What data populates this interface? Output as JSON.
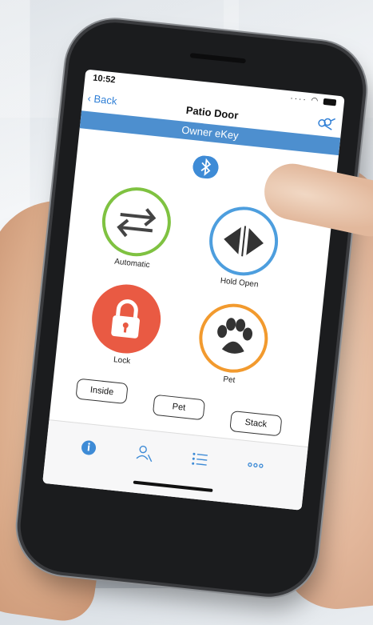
{
  "status": {
    "time": "10:52",
    "signal": "····"
  },
  "nav": {
    "back_label": "Back",
    "title": "Patio Door"
  },
  "banner": {
    "label": "Owner eKey"
  },
  "modes": [
    {
      "label": "Automatic",
      "color": "#7fc241"
    },
    {
      "label": "Hold Open",
      "color": "#4d9ede"
    },
    {
      "label": "Lock",
      "color": "#e95a43"
    },
    {
      "label": "Pet",
      "color": "#f29a2e"
    }
  ],
  "options": [
    "Inside",
    "Pet",
    "Stack"
  ],
  "tabs": [
    {
      "icon": "info-icon"
    },
    {
      "icon": "users-icon"
    },
    {
      "icon": "list-icon"
    },
    {
      "icon": "more-icon"
    }
  ],
  "colors": {
    "accent": "#4d8fcf",
    "bluetooth": "#3e8bd6"
  }
}
